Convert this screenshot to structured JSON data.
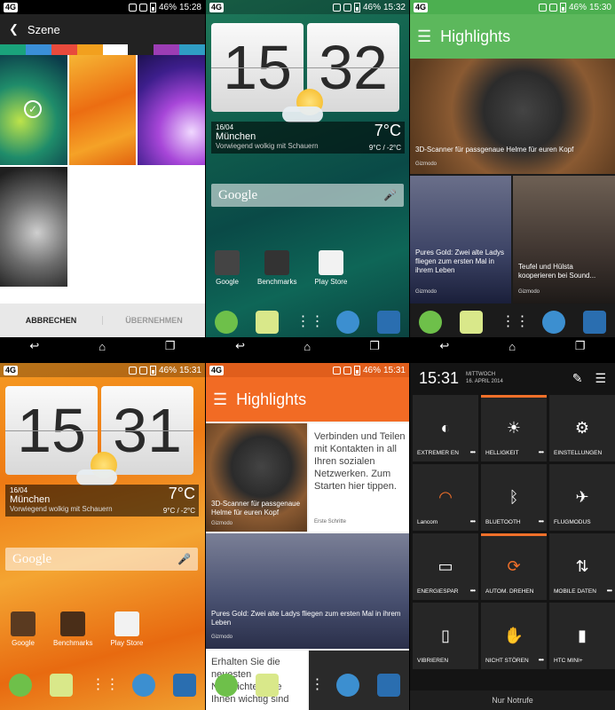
{
  "status": {
    "network": "4G",
    "battery_p1": "46%",
    "time_p1": "15:28",
    "battery_p2": "46%",
    "time_p2": "15:32",
    "battery_p3": "46%",
    "time_p3": "15:30",
    "battery_p4": "46%",
    "time_p4": "15:31",
    "battery_p5": "46%",
    "time_p5": "15:31"
  },
  "scene": {
    "title": "Szene",
    "cancel": "ABBRECHEN",
    "apply": "ÜBERNEHMEN"
  },
  "home_green": {
    "hour": "15",
    "minute": "32",
    "date": "16/04",
    "city": "München",
    "condition": "Vorwiegend wolkig mit Schauern",
    "temp": "7°C",
    "range": "9°C / -2°C",
    "search": "Google",
    "apps": [
      "Google",
      "Benchmarks",
      "Play Store"
    ]
  },
  "home_orange": {
    "hour": "15",
    "minute": "31",
    "date": "16/04",
    "city": "München",
    "condition": "Vorwiegend wolkig mit Schauern",
    "temp": "7°C",
    "range": "9°C / -2°C",
    "search": "Google",
    "apps": [
      "Google",
      "Benchmarks",
      "Play Store"
    ]
  },
  "blinkfeed_green": {
    "title": "Highlights",
    "story1": "3D-Scanner für passgenaue Helme für euren Kopf",
    "story1_src": "Gizmodo",
    "story2": "Pures Gold: Zwei alte Ladys fliegen zum ersten Mal in ihrem Leben",
    "story2_src": "Gizmodo",
    "story3": "Teufel und Hülsta kooperieren bei Sound...",
    "story3_src": "Gizmodo"
  },
  "blinkfeed_orange": {
    "title": "Highlights",
    "story1": "3D-Scanner für passgenaue Helme für euren Kopf",
    "story1_src": "Gizmodo",
    "promo": "Verbinden und Teilen mit Kontakten in all Ihren sozialen Netzwerken. Zum Starten hier tippen.",
    "promo_src": "Erste Schritte",
    "story2": "Pures Gold: Zwei alte Ladys fliegen zum ersten Mal in ihrem Leben",
    "story2_src": "Gizmodo",
    "promo2": "Erhalten Sie die neuesten Nachrichten, die Ihnen wichtig sind"
  },
  "quick_settings": {
    "time": "15:31",
    "weekday": "MITTWOCH",
    "date": "16. APRIL 2014",
    "tiles": [
      "EXTREMER EN",
      "HELLIGKEIT",
      "EINSTELLUNGEN",
      "Lancom",
      "BLUETOOTH",
      "FLUGMODUS",
      "ENERGIESPAR",
      "AUTOM. DREHEN",
      "MOBILE DATEN",
      "VIBRIEREN",
      "NICHT STÖREN",
      "HTC MINI+"
    ],
    "footer": "Nur Notrufe"
  },
  "colors": {
    "accent_orange": "#f2702a",
    "blinkfeed_green": "#5cb85c",
    "blinkfeed_orange": "#f26b24"
  }
}
